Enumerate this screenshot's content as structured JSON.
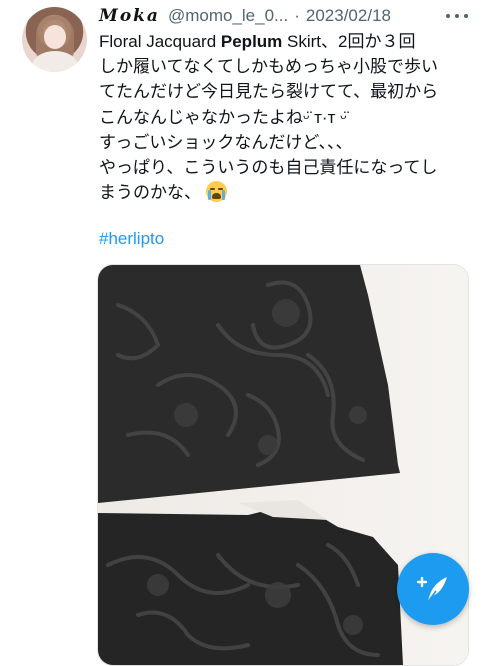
{
  "tweet": {
    "author": {
      "display_name": "𝑴𝒐𝒌𝒂",
      "handle": "@momo_le_0...",
      "separator": "·",
      "date": "2023/02/18"
    },
    "text_parts": {
      "p1": "Floral Jacquard ",
      "p2": "Peplum",
      "p3": " Skirt、2回か３回\nしか履いてなくてしかもめっちゃ小股で歩い\nてたんだけど今日見たら裂けてて、最初から\nこんなんじゃなかったよねᵕ̈ т·т ᵕ̈\nすっごいショックなんだけど、、、\nやっぱり、こういうのも自己責任になってし\nまうのかな、"
    },
    "emoji": "loudly-crying-face",
    "hashtag": "#herlipto",
    "media": {
      "description_icon": "photo"
    }
  },
  "fab": {
    "icon": "compose-tweet-icon"
  },
  "colors": {
    "accent": "#1d9bf0",
    "text": "#0f1419",
    "secondary": "#536471"
  }
}
